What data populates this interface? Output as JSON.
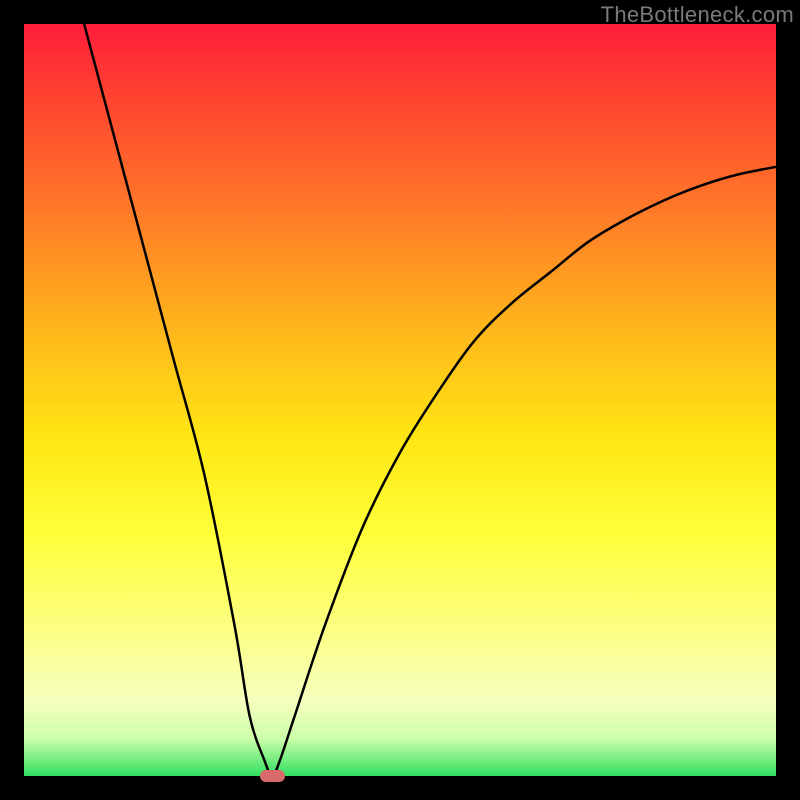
{
  "watermark": "TheBottleneck.com",
  "colors": {
    "border": "#000000",
    "curve": "#000000",
    "marker": "#D96A6A"
  },
  "chart_data": {
    "type": "line",
    "title": "",
    "xlabel": "",
    "ylabel": "",
    "xlim": [
      0,
      100
    ],
    "ylim": [
      0,
      100
    ],
    "grid": false,
    "legend": false,
    "annotations": [],
    "series": [
      {
        "name": "bottleneck-curve",
        "x": [
          8,
          12,
          16,
          20,
          24,
          28,
          30,
          32,
          33,
          34,
          36,
          40,
          45,
          50,
          55,
          60,
          65,
          70,
          75,
          80,
          85,
          90,
          95,
          100
        ],
        "y": [
          100,
          85,
          70,
          55,
          40,
          20,
          8,
          2,
          0,
          2,
          8,
          20,
          33,
          43,
          51,
          58,
          63,
          67,
          71,
          74,
          76.5,
          78.5,
          80,
          81
        ]
      }
    ],
    "marker": {
      "x": 33,
      "y": 0,
      "width_pct": 3.3,
      "height_pct": 1.6
    }
  }
}
